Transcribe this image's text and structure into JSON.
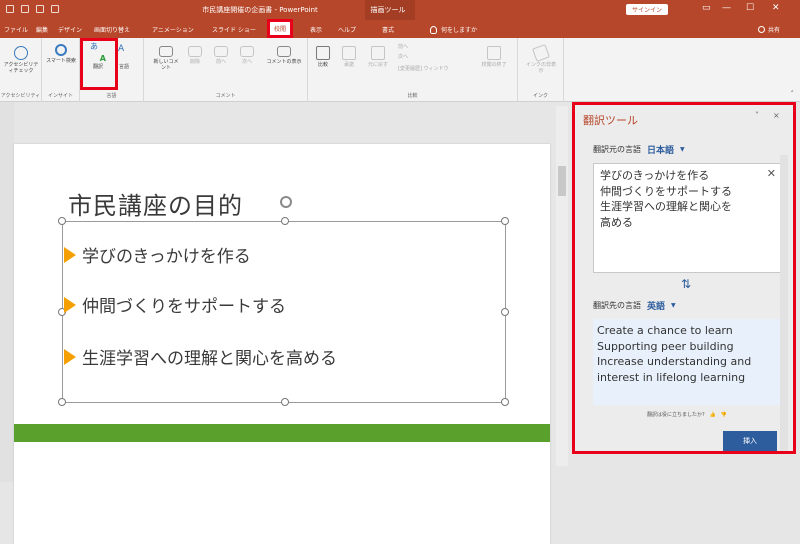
{
  "titlebar": {
    "doc_title": "市民講座開催の企画書 - PowerPoint",
    "context_title": "描画ツール",
    "signin": "サインイン",
    "min": "—",
    "max": "☐",
    "close": "✕"
  },
  "tabs": [
    {
      "label": "ファイル"
    },
    {
      "label": "編集"
    },
    {
      "label": "デザイン"
    },
    {
      "label": "画面切り替え"
    },
    {
      "label": "アニメーション"
    },
    {
      "label": "スライド ショー"
    },
    {
      "label": "校閲"
    },
    {
      "label": "表示"
    },
    {
      "label": "ヘルプ"
    },
    {
      "label": "書式"
    }
  ],
  "tellme": "何をしますか",
  "share": "共有",
  "ribbon": {
    "groups": [
      {
        "label": "アクセシビリティ"
      },
      {
        "label": "インサイト"
      },
      {
        "label": "言語"
      },
      {
        "label": "コメント"
      },
      {
        "label": "比較"
      },
      {
        "label": "インク"
      }
    ],
    "buttons": {
      "accessibility": "アクセシビリティチェック",
      "smart_lookup": "スマート検索",
      "translate": "翻訳",
      "language": "言語",
      "new_comment": "新しいコメント",
      "delete": "削除",
      "prev": "前へ",
      "next": "次へ",
      "show_comments": "コメントの表示",
      "compare": "比較",
      "accept": "承諾",
      "reject": "元に戻す",
      "prev2": "前へ",
      "next2": "次へ",
      "review_pane": "[変更履歴] ウィンドウ",
      "end_review": "校閲の終了",
      "ink_hide": "インクの非表示"
    }
  },
  "slide": {
    "title": "市民講座の目的",
    "bullets": [
      "学びのきっかけを作る",
      "仲間づくりをサポートする",
      "生涯学習への理解と関心を高める"
    ]
  },
  "translator": {
    "title": "翻訳ツール",
    "source_label": "翻訳元の言語",
    "source_lang": "日本語",
    "source_lines": [
      "学びのきっかけを作る",
      "仲間づくりをサポートする",
      "生涯学習への理解と関心を",
      "高める"
    ],
    "target_label": "翻訳先の言語",
    "target_lang": "英語",
    "target_lines": [
      "Create a chance to learn",
      "Supporting peer building",
      "Increase understanding and",
      "interest in lifelong learning"
    ],
    "feedback": "翻訳は役に立ちましたか?",
    "insert": "挿入",
    "close": "×",
    "options": "˅"
  },
  "colors": {
    "accent": "#b7472a",
    "highlight": "#e8001a",
    "bullet_arrow": "#f5a000",
    "green_bar": "#5aa02c",
    "insert": "#2e5d9e"
  }
}
